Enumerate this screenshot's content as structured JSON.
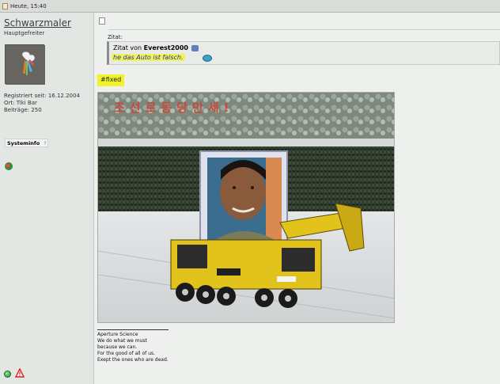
{
  "window": {
    "title": "Heute, 15:40"
  },
  "user": {
    "name": "Schwarzmaler",
    "rank": "Hauptgefreiter",
    "registered": "Registriert seit: 16.12.2004",
    "location": "Ort: Tiki Bar",
    "posts": "Beiträge: 250",
    "sysinfo_label": "Systeminfo",
    "sysinfo_help": "?"
  },
  "post": {
    "quote_label": "Zitat:",
    "quote_prefix": "Zitat von ",
    "quote_author": "Everest2000",
    "quote_text": "he das Auto ist falsch.",
    "fixed_text": "#fixed",
    "image_banner": "조선로동당만세!"
  },
  "signature": {
    "line1": "Aperture Science",
    "line2": "We do what we must",
    "line3": "because we can.",
    "line4": "For the good of all of us.",
    "line5": "Exept the ones who are dead."
  },
  "colors": {
    "highlight": "#f2f22c",
    "quote_text": "#1d3a9a",
    "crane_yellow": "#e2c31c"
  }
}
